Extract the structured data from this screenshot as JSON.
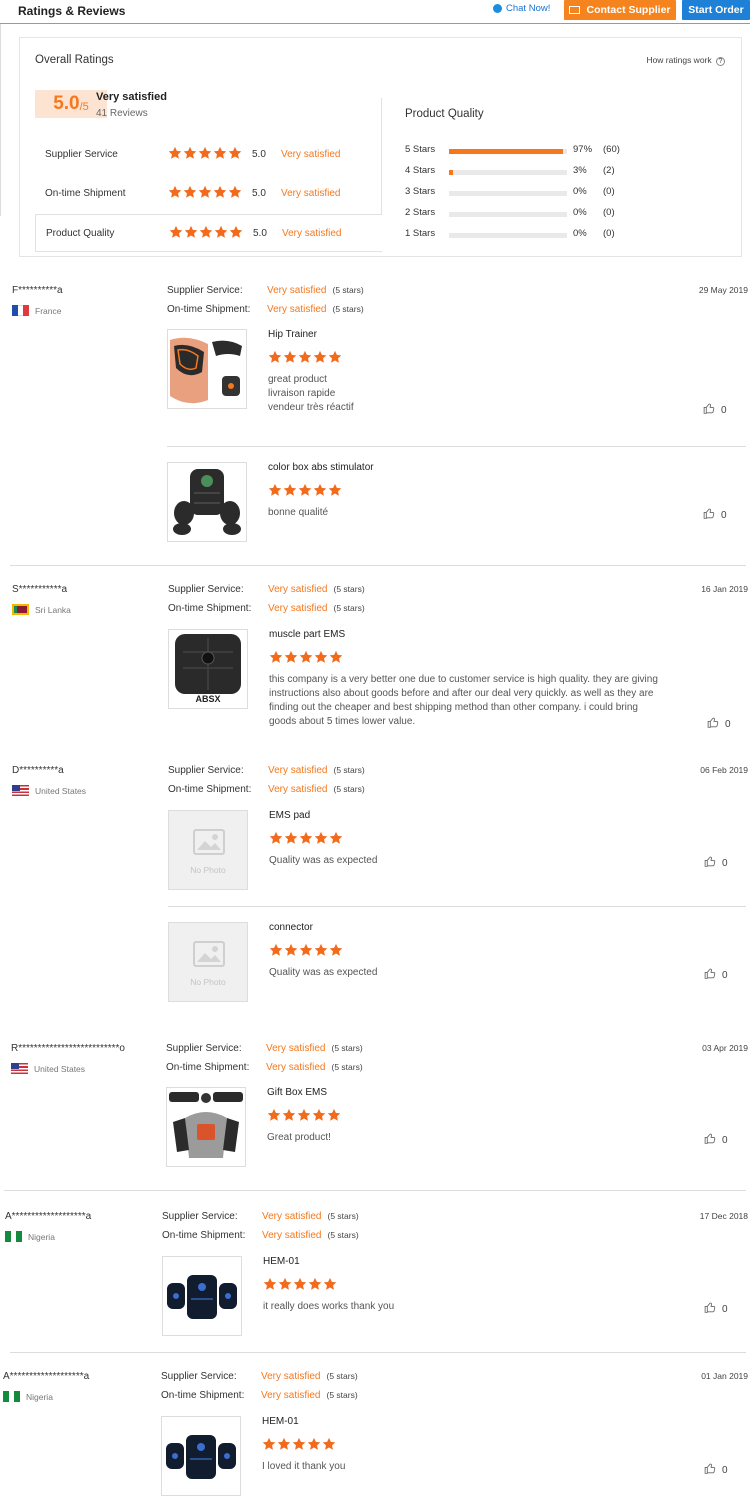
{
  "header": {
    "title": "Ratings & Reviews",
    "chat_label": "Chat Now!",
    "contact_label": "Contact Supplier",
    "order_label": "Start Order"
  },
  "summary": {
    "title": "Overall Ratings",
    "how_ratings_work": "How ratings work",
    "help_symbol": "?",
    "score": "5.0",
    "score_out_of": "/5",
    "score_text": "Very satisfied",
    "review_count": "41 Reviews",
    "rows": [
      {
        "label": "Supplier Service",
        "value": "5.0",
        "text": "Very satisfied",
        "stars": 5
      },
      {
        "label": "On-time Shipment",
        "value": "5.0",
        "text": "Very satisfied",
        "stars": 5
      },
      {
        "label": "Product Quality",
        "value": "5.0",
        "text": "Very satisfied",
        "stars": 5
      }
    ],
    "quality_title": "Product Quality",
    "distribution": [
      {
        "label": "5 Stars",
        "percent": "97%",
        "count": "(60)",
        "fraction": 0.97
      },
      {
        "label": "4 Stars",
        "percent": "3%",
        "count": "(2)",
        "fraction": 0.03
      },
      {
        "label": "3 Stars",
        "percent": "0%",
        "count": "(0)",
        "fraction": 0
      },
      {
        "label": "2 Stars",
        "percent": "0%",
        "count": "(0)",
        "fraction": 0
      },
      {
        "label": "1 Stars",
        "percent": "0%",
        "count": "(0)",
        "fraction": 0
      }
    ]
  },
  "labels": {
    "supplier_service": "Supplier Service:",
    "on_time_shipment": "On-time Shipment:",
    "very_satisfied": "Very satisfied",
    "five_stars": "(5 stars)",
    "no_photo": "No Photo"
  },
  "reviews": [
    {
      "user": "F**********a",
      "country": "France",
      "flag": "fr",
      "date": "29 May 2019",
      "items": [
        {
          "product": "Hip Trainer",
          "text": "great product\nlivraison rapide\nvendeur très réactif",
          "likes": "0",
          "image": "hip"
        },
        {
          "product": "color box abs stimulator",
          "text": "bonne qualité",
          "likes": "0",
          "image": "abs"
        }
      ]
    },
    {
      "user": "S***********a",
      "country": "Sri Lanka",
      "flag": "lk",
      "date": "16 Jan 2019",
      "items": [
        {
          "product": "muscle part EMS",
          "text": "this company is a very better one due to customer service is high quality. they are giving instructions also about goods before and after our deal very quickly. as well as they are finding out the cheaper and best shipping method than other company. i could bring goods about 5 times lower value.",
          "likes": "0",
          "image": "absx",
          "image_text": "ABSX"
        }
      ]
    },
    {
      "user": "D**********a",
      "country": "United States",
      "flag": "us",
      "date": "06 Feb 2019",
      "items": [
        {
          "product": "EMS pad",
          "text": "Quality was as expected",
          "likes": "0",
          "image": "none"
        },
        {
          "product": "connector",
          "text": "Quality was as expected",
          "likes": "0",
          "image": "none"
        }
      ]
    },
    {
      "user": "R**************************o",
      "country": "United States",
      "flag": "us",
      "date": "03 Apr 2019",
      "items": [
        {
          "product": "Gift Box EMS",
          "text": "Great product!",
          "likes": "0",
          "image": "gift"
        }
      ]
    },
    {
      "user": "A*******************a",
      "country": "Nigeria",
      "flag": "ng",
      "date": "17 Dec 2018",
      "items": [
        {
          "product": "HEM-01",
          "text": "it really does works thank you",
          "likes": "0",
          "image": "hem"
        }
      ]
    },
    {
      "user": "A*******************a",
      "country": "Nigeria",
      "flag": "ng",
      "date": "01 Jan 2019",
      "items": [
        {
          "product": "HEM-01",
          "text": "I loved it thank you",
          "likes": "0",
          "image": "hem"
        }
      ]
    }
  ],
  "colors": {
    "accent": "#f5781e",
    "blue": "#1e80d6",
    "star": "#f26b1d"
  }
}
